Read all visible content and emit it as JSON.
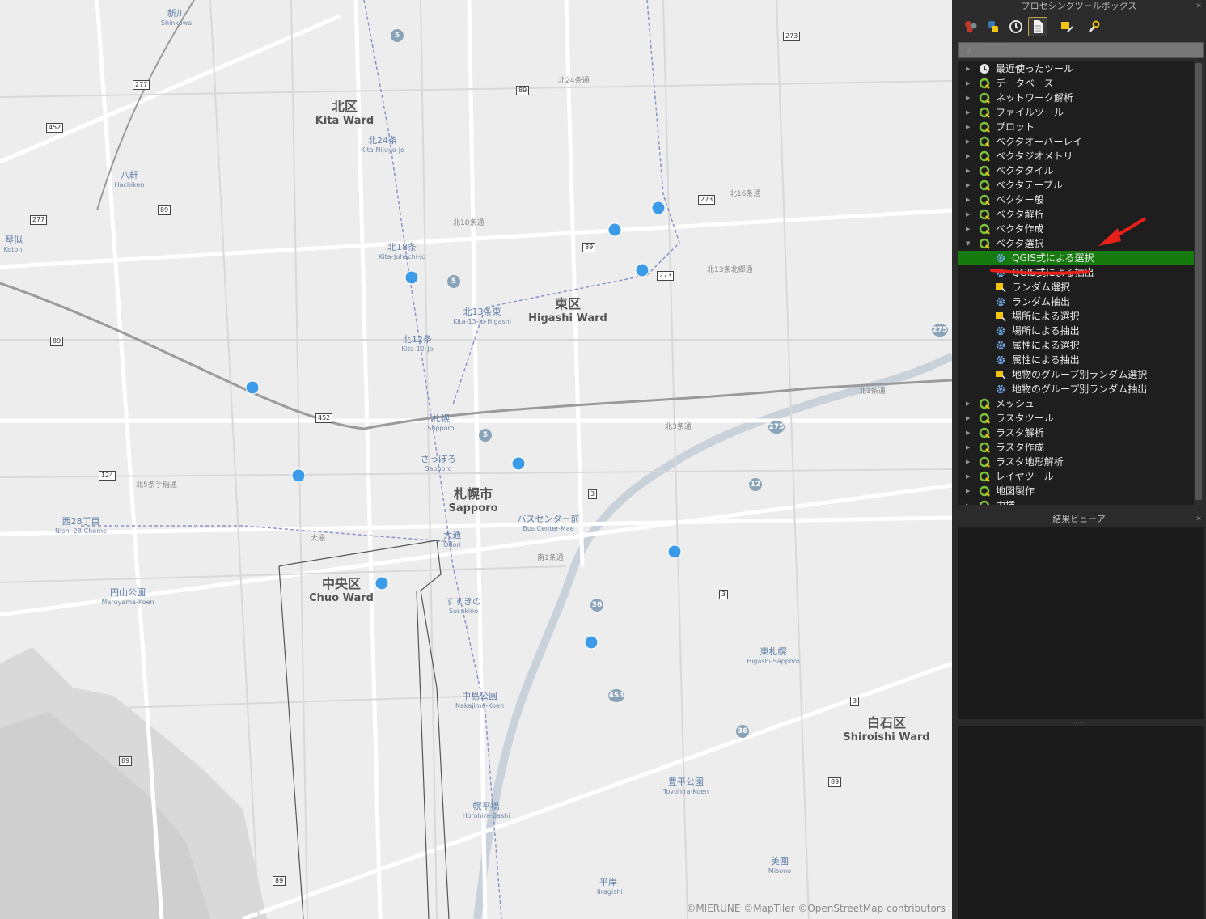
{
  "map": {
    "wards": [
      {
        "ja": "北区",
        "en": "Kita Ward"
      },
      {
        "ja": "東区",
        "en": "Higashi Ward"
      },
      {
        "ja": "札幌市",
        "en": "Sapporo"
      },
      {
        "ja": "中央区",
        "en": "Chuo Ward"
      },
      {
        "ja": "白石区",
        "en": "Shiroishi Ward"
      }
    ],
    "stations": [
      {
        "ja": "新川",
        "en": "Shinkawa"
      },
      {
        "ja": "八軒",
        "en": "Hachiken"
      },
      {
        "ja": "北24条",
        "en": "Kita-Nijuyo-jo"
      },
      {
        "ja": "北18条",
        "en": "Kita-Juhachi-jo"
      },
      {
        "ja": "北12条",
        "en": "Kita-12-Jo"
      },
      {
        "ja": "北13条東",
        "en": "Kita-13-Jo-Higashi"
      },
      {
        "ja": "札幌",
        "en": "Sapporo"
      },
      {
        "ja": "さっぽろ",
        "en": "Sapporo"
      },
      {
        "ja": "大通",
        "en": "Odori"
      },
      {
        "ja": "バスセンター前",
        "en": "Bus Center-Mae"
      },
      {
        "ja": "西28丁目",
        "en": "Nishi-28-Chome"
      },
      {
        "ja": "円山公園",
        "en": "Maruyama-Koen"
      },
      {
        "ja": "すすきの",
        "en": "Susukino"
      },
      {
        "ja": "中島公園",
        "en": "Nakajima-Koen"
      },
      {
        "ja": "東札幌",
        "en": "Higashi-Sapporo"
      },
      {
        "ja": "豊平公園",
        "en": "Toyohira-Koen"
      },
      {
        "ja": "幌平橋",
        "en": "Horohira-Bashi"
      },
      {
        "ja": "平岸",
        "en": "Hiragishi"
      },
      {
        "ja": "美園",
        "en": "Misono"
      },
      {
        "ja": "琴似",
        "en": "Kotoni"
      }
    ],
    "roads": [
      "北24条通",
      "北18条通",
      "北5条手稲通",
      "大通",
      "北1条通",
      "北3条通",
      "南1条通",
      "北13条北郷通",
      "北16条通"
    ],
    "route_shields": [
      "5",
      "5",
      "5",
      "275",
      "275",
      "36",
      "36",
      "453",
      "12"
    ],
    "route_boxes": [
      "277",
      "452",
      "89",
      "277",
      "89",
      "89",
      "124",
      "452",
      "89",
      "89",
      "89",
      "273",
      "273",
      "89",
      "273",
      "3",
      "3",
      "3",
      "89",
      "89"
    ],
    "attribution": "©MIERUNE ©MapTiler ©OpenStreetMap contributors"
  },
  "toolbox": {
    "title": "プロセシングツールボックス",
    "toolbar": [
      "models-icon",
      "python-icon",
      "history-icon",
      "results-icon",
      "edit-features-icon",
      "options-icon"
    ],
    "search_placeholder": "検索...",
    "items": [
      {
        "label": "最近使ったツール",
        "icon": "clock-icon",
        "expanded": false
      },
      {
        "label": "データベース",
        "icon": "qgis-icon",
        "expanded": false
      },
      {
        "label": "ネットワーク解析",
        "icon": "qgis-icon",
        "expanded": false
      },
      {
        "label": "ファイルツール",
        "icon": "qgis-icon",
        "expanded": false
      },
      {
        "label": "プロット",
        "icon": "qgis-icon",
        "expanded": false
      },
      {
        "label": "ベクタオーバーレイ",
        "icon": "qgis-icon",
        "expanded": false
      },
      {
        "label": "ベクタジオメトリ",
        "icon": "qgis-icon",
        "expanded": false
      },
      {
        "label": "ベクタタイル",
        "icon": "qgis-icon",
        "expanded": false
      },
      {
        "label": "ベクタテーブル",
        "icon": "qgis-icon",
        "expanded": false
      },
      {
        "label": "ベクター般",
        "icon": "qgis-icon",
        "expanded": false
      },
      {
        "label": "ベクタ解析",
        "icon": "qgis-icon",
        "expanded": false
      },
      {
        "label": "ベクタ作成",
        "icon": "qgis-icon",
        "expanded": false
      },
      {
        "label": "ベクタ選択",
        "icon": "qgis-icon",
        "expanded": true
      }
    ],
    "children": [
      {
        "label": "QGIS式による選択",
        "icon": "gear-icon",
        "selected": true
      },
      {
        "label": "QGIS式による抽出",
        "icon": "gear-icon"
      },
      {
        "label": "ランダム選択",
        "icon": "select-icon"
      },
      {
        "label": "ランダム抽出",
        "icon": "gear-icon"
      },
      {
        "label": "場所による選択",
        "icon": "select-icon"
      },
      {
        "label": "場所による抽出",
        "icon": "gear-icon"
      },
      {
        "label": "属性による選択",
        "icon": "gear-icon"
      },
      {
        "label": "属性による抽出",
        "icon": "gear-icon"
      },
      {
        "label": "地物のグループ別ランダム選択",
        "icon": "select-icon"
      },
      {
        "label": "地物のグループ別ランダム抽出",
        "icon": "gear-icon"
      }
    ],
    "after": [
      {
        "label": "メッシュ",
        "icon": "qgis-icon"
      },
      {
        "label": "ラスタツール",
        "icon": "qgis-icon"
      },
      {
        "label": "ラスタ解析",
        "icon": "qgis-icon"
      },
      {
        "label": "ラスタ作成",
        "icon": "qgis-icon"
      },
      {
        "label": "ラスタ地形解析",
        "icon": "qgis-icon"
      },
      {
        "label": "レイヤツール",
        "icon": "qgis-icon"
      },
      {
        "label": "地図製作",
        "icon": "qgis-icon"
      },
      {
        "label": "内挿",
        "icon": "qgis-icon"
      }
    ]
  },
  "results_viewer": {
    "title": "結果ビューア"
  },
  "colors": {
    "highlight": "#177a0e",
    "annotation": "#e8201a",
    "point": "#3b9be8"
  }
}
